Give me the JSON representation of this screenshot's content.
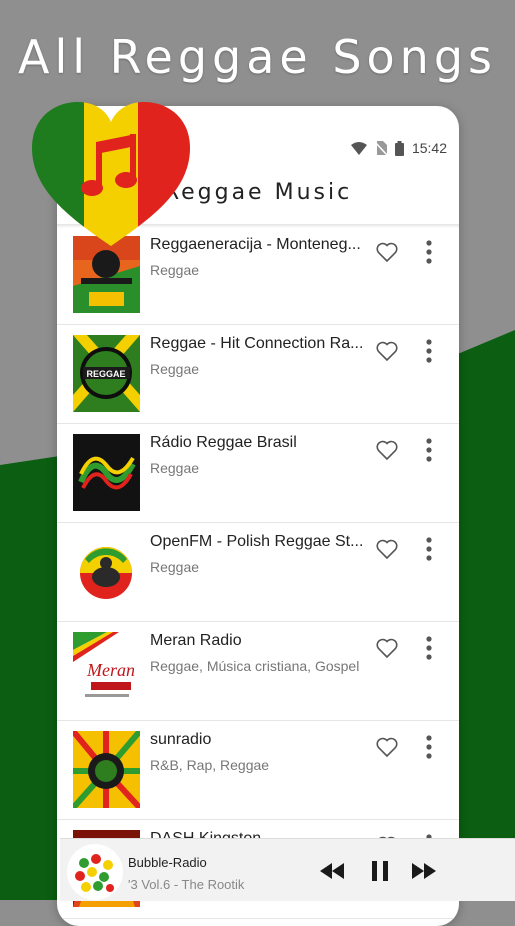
{
  "promo": {
    "headline": "All Reggae Songs"
  },
  "status_bar": {
    "time": "15:42"
  },
  "app_bar": {
    "title": "Reggae Music"
  },
  "stations": [
    {
      "name": "Reggaeneracija - Monteneg...",
      "genres": "Reggae"
    },
    {
      "name": "Reggae - Hit Connection Ra...",
      "genres": "Reggae",
      "thumb_text": "REGGAE"
    },
    {
      "name": "Rádio Reggae Brasil",
      "genres": "Reggae"
    },
    {
      "name": "OpenFM - Polish Reggae St...",
      "genres": "Reggae"
    },
    {
      "name": "Meran Radio",
      "genres": "Reggae, Música cristiana, Gospel",
      "thumb_text": "Meran"
    },
    {
      "name": "sunradio",
      "genres": " R&B, Rap, Reggae"
    },
    {
      "name": "DASH Kingston",
      "genres": ""
    }
  ],
  "player": {
    "title": "Bubble-Radio",
    "subtitle": "'3          Vol.6 - The Rootik"
  },
  "colors": {
    "rasta_green": "#1e7b1e",
    "rasta_yellow": "#f5d000",
    "rasta_red": "#e0231c",
    "bg_gray": "#8f8f8f",
    "bg_green": "#0b5e12"
  },
  "icons": {
    "logo": "music-note-heart-icon",
    "row_favorite": "heart-outline-icon",
    "row_menu": "more-vert-icon",
    "player_prev": "rewind-icon",
    "player_pause": "pause-icon",
    "player_next": "fast-forward-icon"
  }
}
